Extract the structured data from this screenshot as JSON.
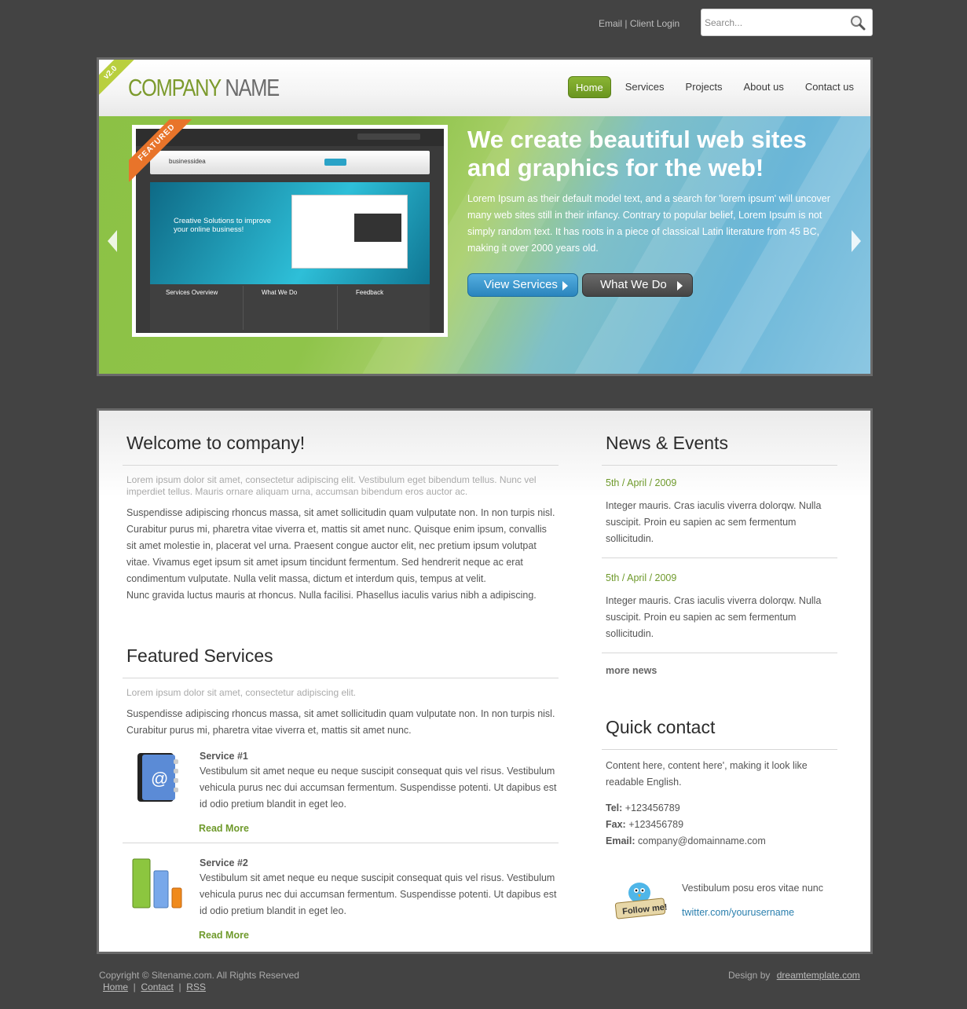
{
  "top": {
    "links": [
      "Email",
      "Client Login"
    ],
    "search_placeholder": "Search..."
  },
  "header": {
    "badge": "v2.0",
    "logo_part1": "COMPANY",
    "logo_part2": " NAME",
    "nav": [
      "Home",
      "Services",
      "Projects",
      "About us",
      "Contact us"
    ],
    "active_nav": "Home"
  },
  "hero": {
    "featured_label": "FEATURED",
    "title": "We create beautiful web sites and graphics for the web!",
    "text": "Lorem Ipsum as their default model text, and a search for 'lorem ipsum' will uncover many web sites still in their infancy. Contrary to popular belief, Lorem Ipsum is not simply random text. It has roots in a piece of classical Latin literature from 45 BC, making it over 2000 years old.",
    "btn_view": "View Services",
    "btn_what": "What We Do",
    "preview": {
      "brand": "businessidea",
      "banner": "Creative Solutions to improve your online business!",
      "cols": [
        "Services Overview",
        "What We Do",
        "Feedback"
      ]
    }
  },
  "main": {
    "welcome_title": "Welcome to company!",
    "welcome_lead": "Lorem ipsum dolor sit amet, consectetur adipiscing elit. Vestibulum eget bibendum tellus. Nunc vel imperdiet tellus. Mauris ornare aliquam urna, accumsan bibendum eros auctor ac.",
    "welcome_body": "Suspendisse adipiscing rhoncus massa, sit amet sollicitudin quam vulputate non. In non turpis nisl. Curabitur purus mi, pharetra vitae viverra et, mattis sit amet nunc. Quisque enim ipsum, convallis sit amet molestie in, placerat vel urna. Praesent congue auctor elit, nec pretium ipsum volutpat vitae. Vivamus eget ipsum sit amet ipsum tincidunt fermentum. Sed hendrerit neque ac erat condimentum vulputate. Nulla velit massa, dictum et interdum quis, tempus at velit.",
    "welcome_body2": "Nunc gravida luctus mauris at rhoncus. Nulla facilisi. Phasellus iaculis varius nibh a adipiscing.",
    "featured_title": "Featured Services",
    "featured_lead": "Lorem ipsum dolor sit amet, consectetur adipiscing elit.",
    "featured_body": "Suspendisse adipiscing rhoncus massa, sit amet sollicitudin quam vulputate non. In non turpis nisl. Curabitur purus mi, pharetra vitae viverra et, mattis sit amet nunc.",
    "services": [
      {
        "title": "Service #1",
        "text": "Vestibulum sit amet neque eu neque suscipit consequat quis vel risus. Vestibulum vehicula purus nec dui accumsan fermentum. Suspendisse potenti. Ut dapibus est id odio pretium blandit in eget leo.",
        "more": "Read More"
      },
      {
        "title": "Service #2",
        "text": "Vestibulum sit amet neque eu neque suscipit consequat quis vel risus. Vestibulum vehicula purus nec dui accumsan fermentum. Suspendisse potenti. Ut dapibus est id odio pretium blandit in eget leo.",
        "more": "Read More"
      }
    ]
  },
  "side": {
    "news_title": "News & Events",
    "news": [
      {
        "date": "5th / April / 2009",
        "text": "Integer mauris. Cras iaculis viverra dolorqw. Nulla suscipit. Proin eu sapien ac sem fermentum sollicitudin."
      },
      {
        "date": "5th / April / 2009",
        "text": "Integer mauris. Cras iaculis viverra dolorqw. Nulla suscipit. Proin eu sapien ac sem fermentum sollicitudin."
      }
    ],
    "more_news": "more news",
    "contact_title": "Quick contact",
    "contact_text": "Content here, content here', making it look like readable English.",
    "tel_label": "Tel:",
    "tel": "+123456789",
    "fax_label": "Fax:",
    "fax": "+123456789",
    "email_label": "Email:",
    "email": "company@domainname.com",
    "twitter_badge": "Follow me!",
    "twitter_text": "Vestibulum posu eros vitae nunc",
    "twitter_link": "twitter.com/yourusername"
  },
  "footer": {
    "copyright": "Copyright © Sitename.com. All Rights Reserved",
    "links": [
      "Home",
      "Contact",
      "RSS"
    ],
    "design_by": "Design by",
    "design_link": "dreamtemplate.com"
  }
}
